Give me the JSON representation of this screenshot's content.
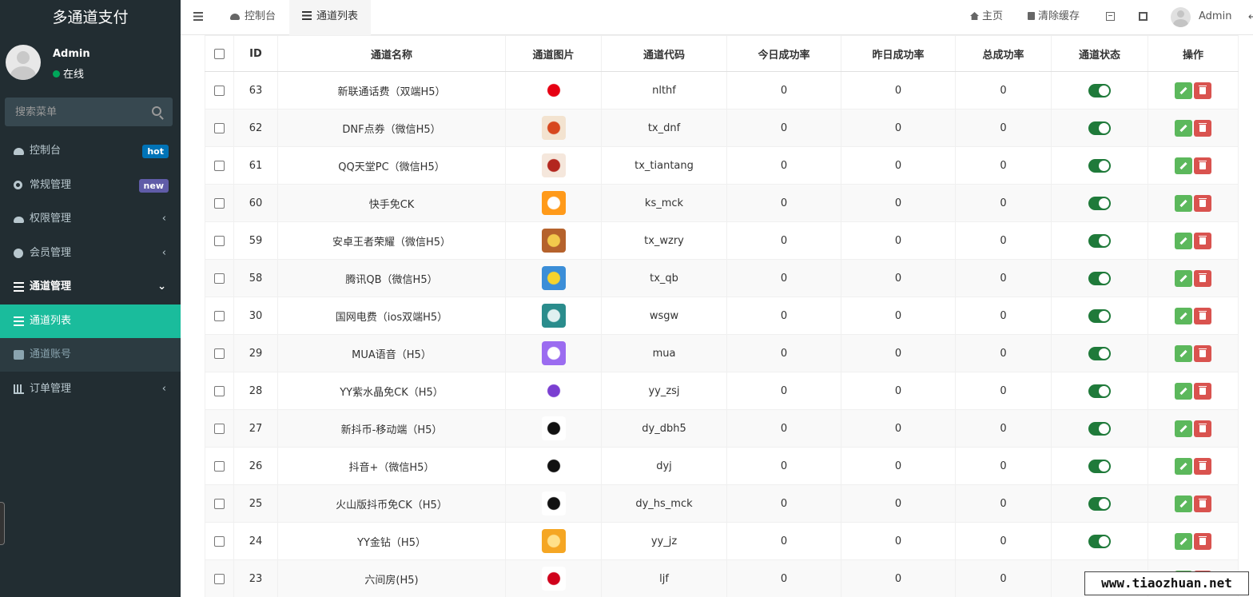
{
  "brand": "多通道支付",
  "user": {
    "name": "Admin",
    "status": "在线"
  },
  "search": {
    "placeholder": "搜索菜单"
  },
  "menu": [
    {
      "label": "控制台",
      "icon": "dashboard-icon",
      "badge": "hot"
    },
    {
      "label": "常规管理",
      "icon": "gears-icon",
      "badge": "new"
    },
    {
      "label": "权限管理",
      "icon": "users-icon",
      "arrow": "‹"
    },
    {
      "label": "会员管理",
      "icon": "user-circle-icon",
      "arrow": "‹"
    },
    {
      "label": "通道管理",
      "icon": "list-icon",
      "arrow": "⌄"
    },
    {
      "label": "通道列表",
      "icon": "list-icon"
    },
    {
      "label": "通道账号",
      "icon": "id-card-icon"
    },
    {
      "label": "订单管理",
      "icon": "bar-chart-icon",
      "arrow": "‹"
    }
  ],
  "tabs": [
    {
      "label": "控制台",
      "icon": "dashboard-icon"
    },
    {
      "label": "通道列表",
      "icon": "list-icon"
    }
  ],
  "topbar": {
    "home": "主页",
    "clear_cache": "清除缓存",
    "admin": "Admin"
  },
  "table": {
    "headers": [
      "ID",
      "通道名称",
      "通道图片",
      "通道代码",
      "今日成功率",
      "昨日成功率",
      "总成功率",
      "通道状态",
      "操作"
    ],
    "rows": [
      {
        "id": "63",
        "name": "新联通话费（双端H5）",
        "code": "nlthf",
        "today": "0",
        "yesterday": "0",
        "total": "0",
        "logo": "unicom-logo",
        "color": "#ffffff",
        "accent": "#e60012"
      },
      {
        "id": "62",
        "name": "DNF点券（微信H5）",
        "code": "tx_dnf",
        "today": "0",
        "yesterday": "0",
        "total": "0",
        "logo": "dnf-logo",
        "color": "#f3e3d0",
        "accent": "#d7471e"
      },
      {
        "id": "61",
        "name": "QQ天堂PC（微信H5）",
        "code": "tx_tiantang",
        "today": "0",
        "yesterday": "0",
        "total": "0",
        "logo": "tiantang-logo",
        "color": "#f5e7dc",
        "accent": "#b3261e"
      },
      {
        "id": "60",
        "name": "快手免CK",
        "code": "ks_mck",
        "today": "0",
        "yesterday": "0",
        "total": "0",
        "logo": "kuaishou-logo",
        "color": "#ff9a1a",
        "accent": "#ffffff"
      },
      {
        "id": "59",
        "name": "安卓王者荣耀（微信H5）",
        "code": "tx_wzry",
        "today": "0",
        "yesterday": "0",
        "total": "0",
        "logo": "wzry-logo",
        "color": "#b5622c",
        "accent": "#f2c94c"
      },
      {
        "id": "58",
        "name": "腾讯QB（微信H5）",
        "code": "tx_qb",
        "today": "0",
        "yesterday": "0",
        "total": "0",
        "logo": "qq-logo",
        "color": "#3b8ed8",
        "accent": "#f6d32d"
      },
      {
        "id": "30",
        "name": "国网电费（ios双端H5）",
        "code": "wsgw",
        "today": "0",
        "yesterday": "0",
        "total": "0",
        "logo": "state-grid-logo",
        "color": "#2a8c8c",
        "accent": "#dff0f0"
      },
      {
        "id": "29",
        "name": "MUA语音（H5）",
        "code": "mua",
        "today": "0",
        "yesterday": "0",
        "total": "0",
        "logo": "mua-logo",
        "color": "#9b6cf0",
        "accent": "#ffffff"
      },
      {
        "id": "28",
        "name": "YY紫水晶免CK（H5）",
        "code": "yy_zsj",
        "today": "0",
        "yesterday": "0",
        "total": "0",
        "logo": "crystal-logo",
        "color": "#ffffff",
        "accent": "#7a3fd1"
      },
      {
        "id": "27",
        "name": "新抖币-移动端（H5）",
        "code": "dy_dbh5",
        "today": "0",
        "yesterday": "0",
        "total": "0",
        "logo": "douyin-logo",
        "color": "#ffffff",
        "accent": "#111111"
      },
      {
        "id": "26",
        "name": "抖音+（微信H5）",
        "code": "dyj",
        "today": "0",
        "yesterday": "0",
        "total": "0",
        "logo": "douyin-plus-logo",
        "color": "#ffffff",
        "accent": "#111111"
      },
      {
        "id": "25",
        "name": "火山版抖币免CK（H5）",
        "code": "dy_hs_mck",
        "today": "0",
        "yesterday": "0",
        "total": "0",
        "logo": "douyin-logo",
        "color": "#ffffff",
        "accent": "#111111"
      },
      {
        "id": "24",
        "name": "YY金钻（H5）",
        "code": "yy_jz",
        "today": "0",
        "yesterday": "0",
        "total": "0",
        "logo": "diamond-logo",
        "color": "#f5a623",
        "accent": "#ffe08a"
      },
      {
        "id": "23",
        "name": "六间房(H5)",
        "code": "ljf",
        "today": "0",
        "yesterday": "0",
        "total": "0",
        "logo": "liujianfang-logo",
        "color": "#ffffff",
        "accent": "#d0021b"
      }
    ]
  },
  "watermark": "www.tiaozhuan.net",
  "colors": {
    "sidebar": "#222d32",
    "active": "#1abc9c",
    "toggle_on": "#1f7a3a",
    "edit": "#5cb85c",
    "delete": "#d9534f"
  }
}
